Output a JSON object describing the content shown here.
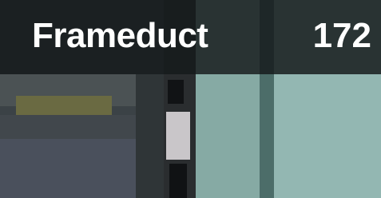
{
  "tile": {
    "title": "Frameduct",
    "count": "172"
  },
  "thumbnail": {
    "icon": "pixelated-image-thumbnail"
  },
  "colors": {
    "header_overlay": "#161a1c",
    "text": "#ffffff",
    "teal_panel": "#8fb3ae"
  }
}
